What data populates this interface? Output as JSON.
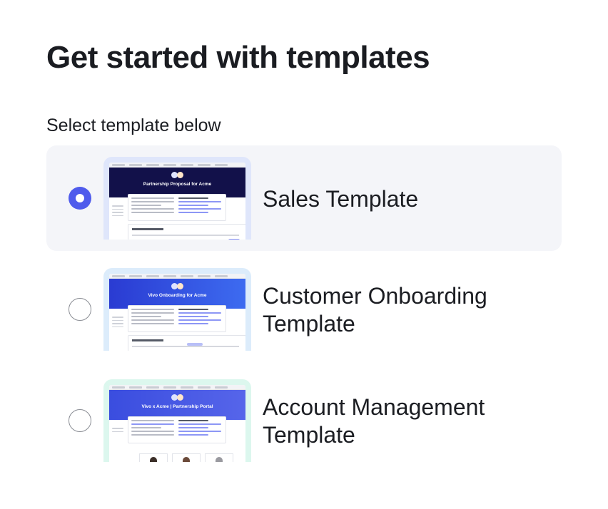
{
  "page": {
    "title": "Get started with templates",
    "subtitle": "Select template below"
  },
  "templates": [
    {
      "name": "Sales Template",
      "selected": true,
      "preview_title": "Partnership Proposal for Acme",
      "preview_hero_color": "#12114a",
      "preview_frame_color": "#dfe6fb"
    },
    {
      "name": "Customer Onboarding Template",
      "name_lines": [
        "Customer Onboarding",
        "Template"
      ],
      "selected": false,
      "preview_title": "Vivo Onboarding for Acme",
      "preview_hero_color": "#2f43d6",
      "preview_frame_color": "#dcecfb"
    },
    {
      "name": "Account Management Template",
      "name_lines": [
        "Account Management",
        "Template"
      ],
      "selected": false,
      "preview_title": "Vivo x Acme | Partnership Portal",
      "preview_hero_color": "#3d4fe0",
      "preview_frame_color": "#dcf7ee"
    }
  ],
  "colors": {
    "accent": "#4f5bec",
    "selected_bg": "#f4f5f9",
    "text": "#1b1d22"
  }
}
